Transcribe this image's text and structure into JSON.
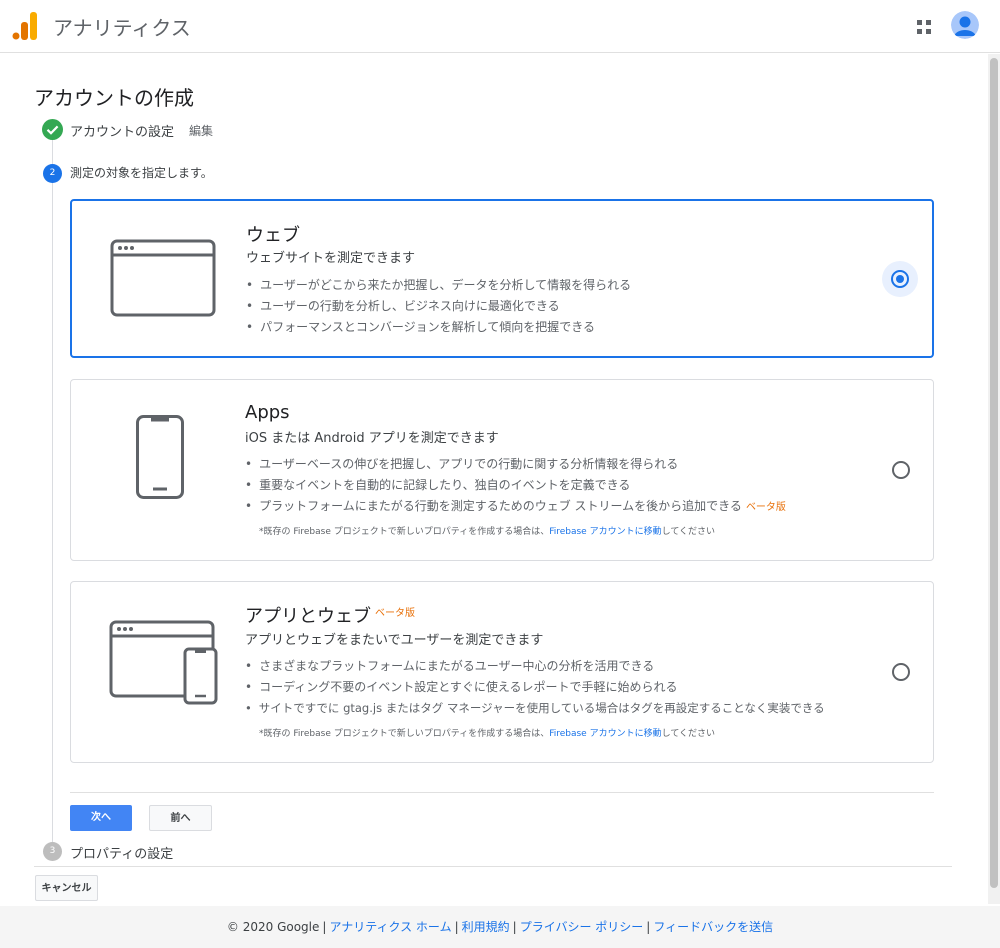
{
  "header": {
    "app_title": "アナリティクス"
  },
  "page_title": "アカウントの作成",
  "steps": {
    "step1": {
      "label": "アカウントの設定",
      "edit": "編集"
    },
    "step2": {
      "number": "2",
      "label": "測定の対象を指定します。"
    },
    "step3": {
      "number": "3",
      "label": "プロパティの設定"
    }
  },
  "options": {
    "web": {
      "title": "ウェブ",
      "subtitle": "ウェブサイトを測定できます",
      "bullets": [
        "ユーザーがどこから来たか把握し、データを分析して情報を得られる",
        "ユーザーの行動を分析し、ビジネス向けに最適化できる",
        "パフォーマンスとコンバージョンを解析して傾向を把握できる"
      ],
      "selected": true
    },
    "apps": {
      "title": "Apps",
      "subtitle": "iOS または Android アプリを測定できます",
      "bullets": [
        "ユーザーベースの伸びを把握し、アプリでの行動に関する分析情報を得られる",
        "重要なイベントを自動的に記録したり、独自のイベントを定義できる",
        "プラットフォームにまたがる行動を測定するためのウェブ ストリームを後から追加できる"
      ],
      "beta": "ベータ版",
      "note_pre": "*既存の Firebase プロジェクトで新しいプロパティを作成する場合は、",
      "note_link": "Firebase アカウントに移動",
      "note_post": "してください",
      "selected": false
    },
    "app_web": {
      "title": "アプリとウェブ",
      "beta": "ベータ版",
      "subtitle": "アプリとウェブをまたいでユーザーを測定できます",
      "bullets": [
        "さまざまなプラットフォームにまたがるユーザー中心の分析を活用できる",
        "コーディング不要のイベント設定とすぐに使えるレポートで手軽に始められる",
        "サイトですでに gtag.js またはタグ マネージャーを使用している場合はタグを再設定することなく実装できる"
      ],
      "note_pre": "*既存の Firebase プロジェクトで新しいプロパティを作成する場合は、",
      "note_link": "Firebase アカウントに移動",
      "note_post": "してください",
      "selected": false
    }
  },
  "buttons": {
    "next": "次へ",
    "prev": "前へ",
    "cancel": "キャンセル"
  },
  "footer": {
    "copyright": "© 2020 Google",
    "links": [
      "アナリティクス ホーム",
      "利用規約",
      "プライバシー ポリシー",
      "フィードバックを送信"
    ]
  },
  "colors": {
    "accent": "#1a73e8",
    "primary_button": "#4285f4",
    "success": "#34a853",
    "beta": "#e8710a"
  }
}
